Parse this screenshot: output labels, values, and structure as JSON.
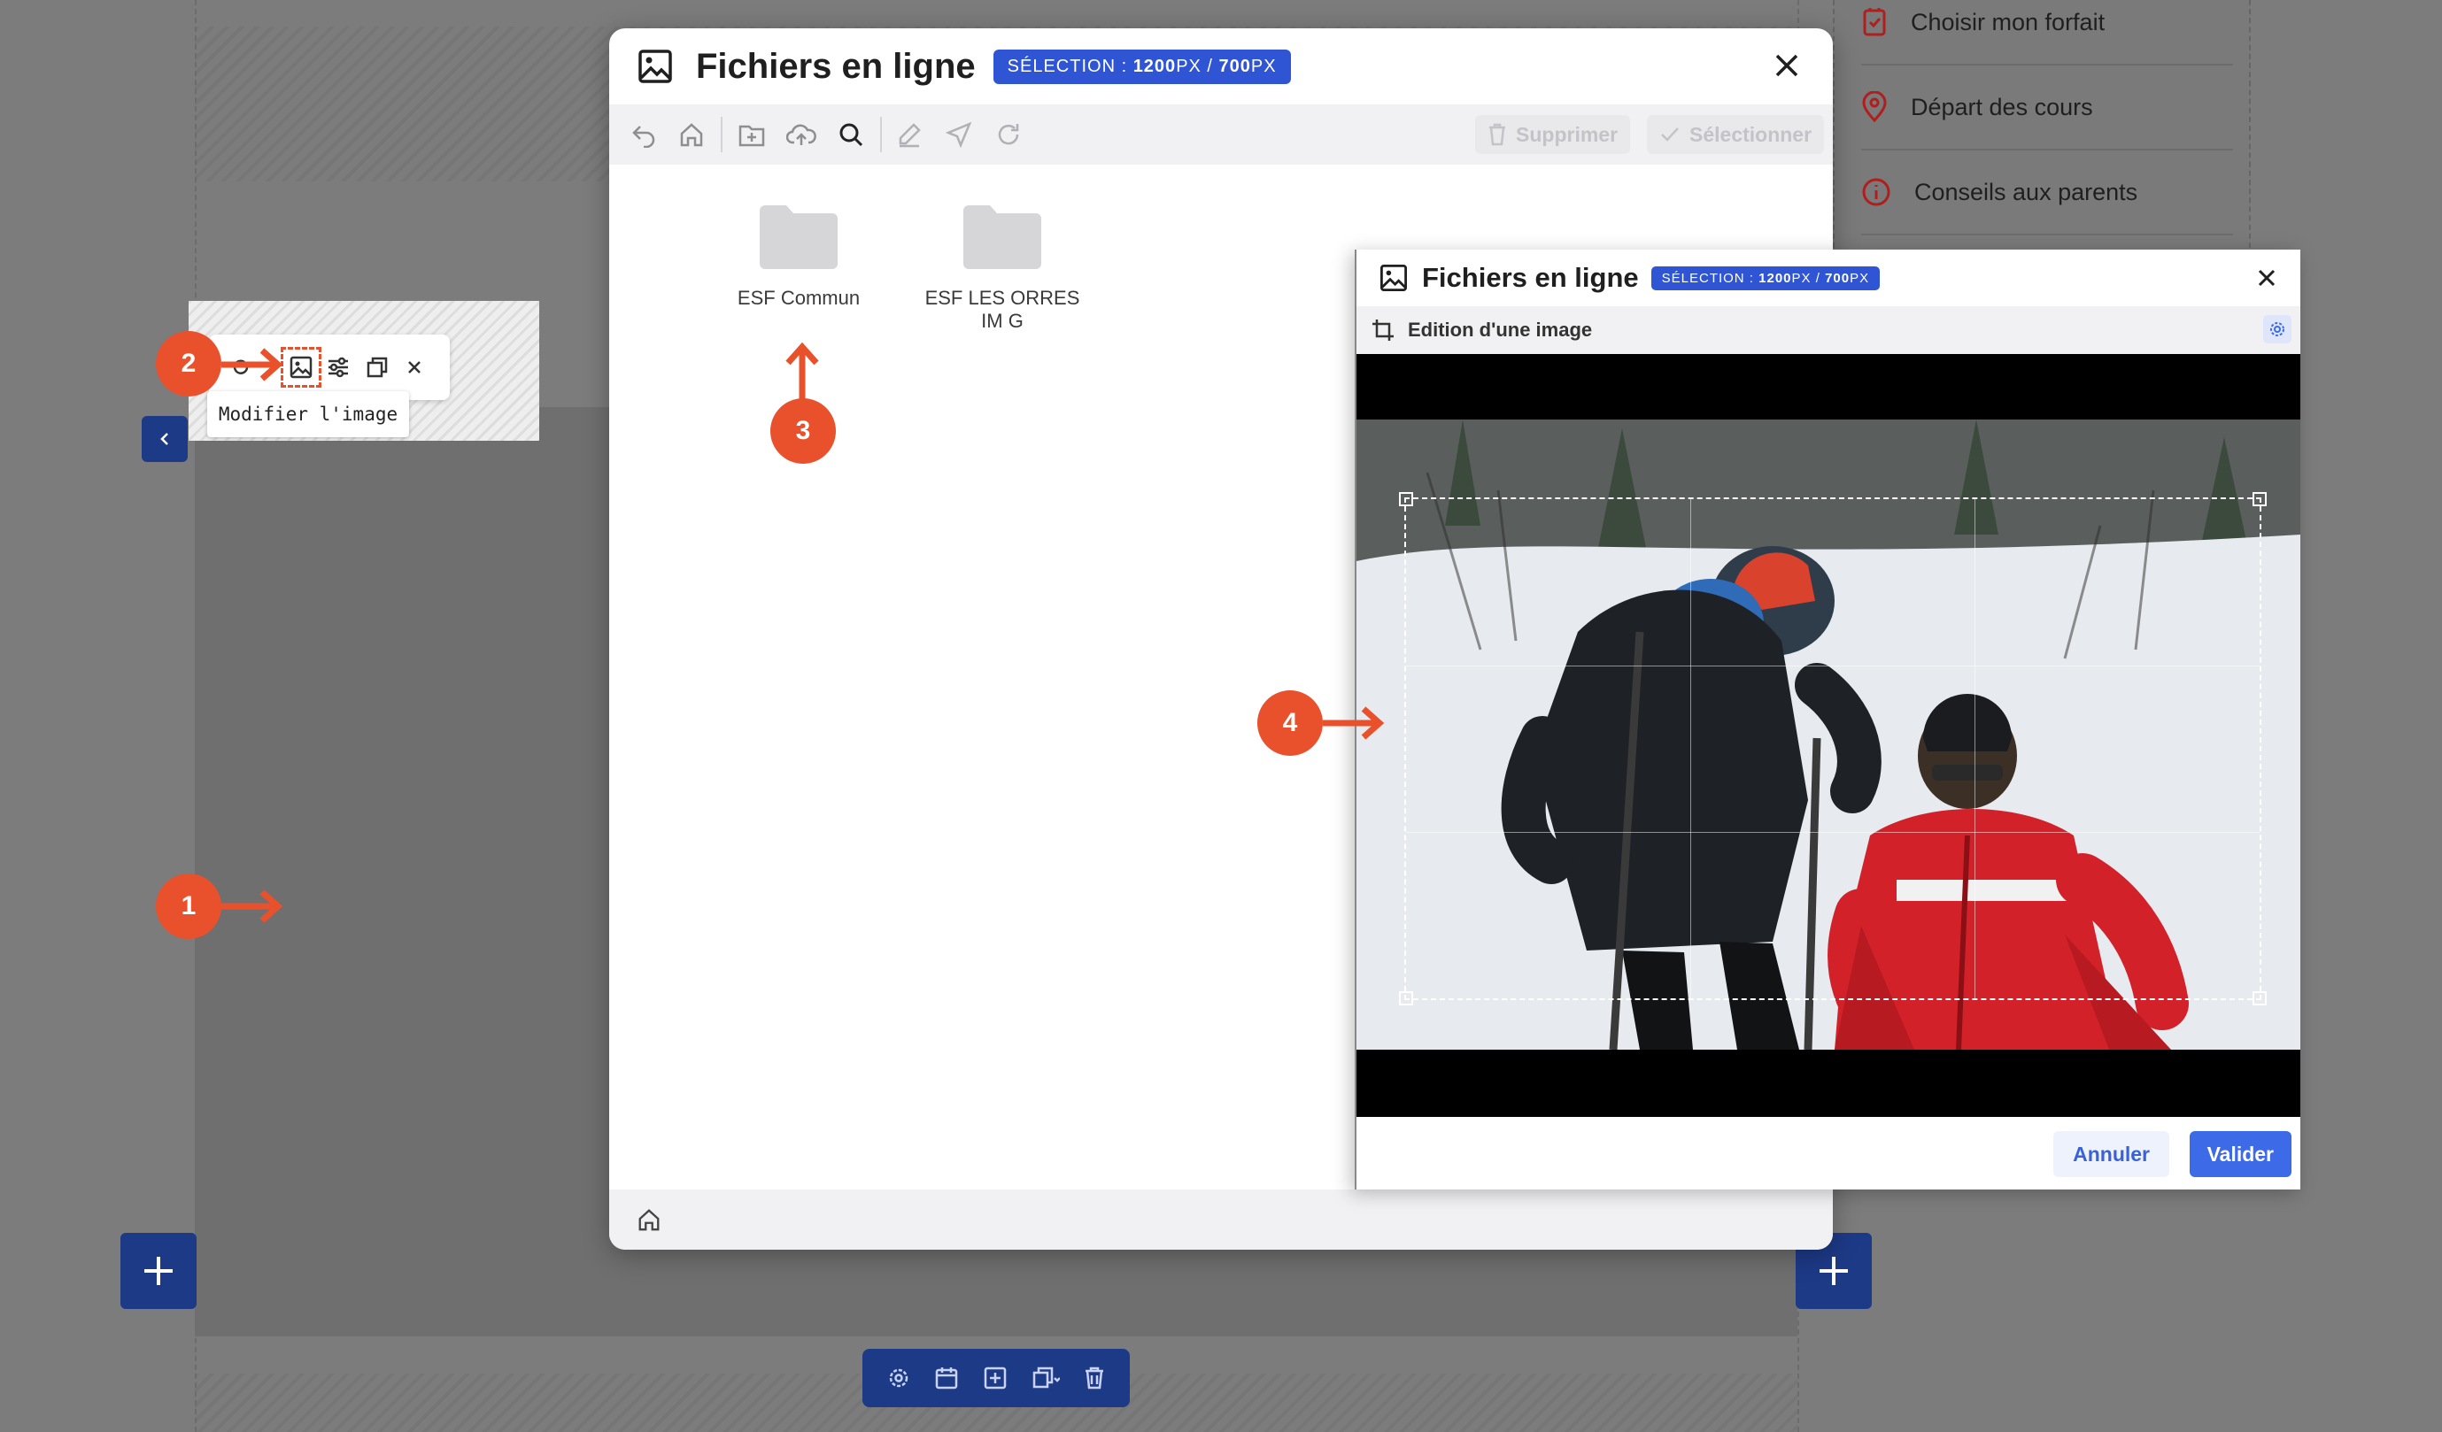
{
  "background": {
    "menu_items": [
      {
        "label": "Choisir mon forfait",
        "icon": "ticket-icon"
      },
      {
        "label": "Départ des cours",
        "icon": "map-pin-icon"
      },
      {
        "label": "Conseils aux parents",
        "icon": "info-icon"
      }
    ],
    "image_toolbar": {
      "tooltip": "Modifier l'image"
    }
  },
  "annotations": [
    "1",
    "2",
    "3",
    "4"
  ],
  "file_manager": {
    "title": "Fichiers en ligne",
    "selection_prefix": "SÉLECTION : ",
    "selection_width": "1200",
    "selection_height": "700",
    "selection_unit": "PX",
    "selection_sep": " / ",
    "actions": {
      "delete": "Supprimer",
      "select": "Sélectionner"
    },
    "folders": [
      {
        "name": "ESF Commun"
      },
      {
        "name": "ESF LES ORRES IM G"
      }
    ]
  },
  "image_editor": {
    "title": "Fichiers en ligne",
    "subtitle": "Edition d'une image",
    "cancel_label": "Annuler",
    "confirm_label": "Valider"
  },
  "colors": {
    "accent": "#2f55d4",
    "annotation": "#e8512b",
    "toolbar_dark": "#1d3a87"
  }
}
